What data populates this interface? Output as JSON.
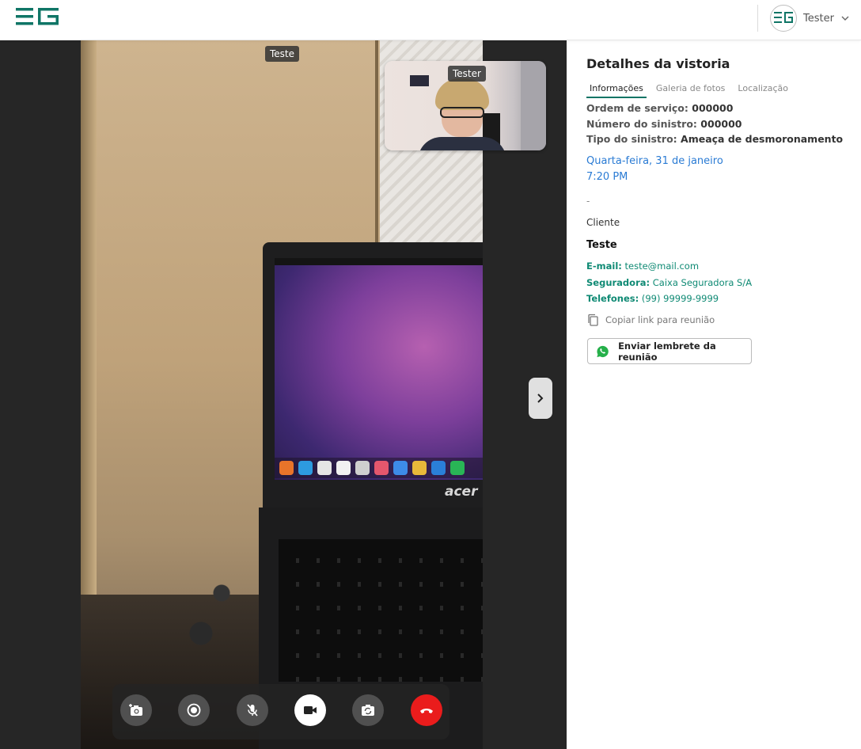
{
  "header": {
    "user_name": "Tester"
  },
  "video": {
    "main_participant_label": "Teste",
    "self_view_label": "Tester",
    "laptop_brand": "acer",
    "controls": [
      {
        "name": "snapshot",
        "icon": "camera-plus-icon"
      },
      {
        "name": "record",
        "icon": "record-icon"
      },
      {
        "name": "mute",
        "icon": "mic-off-icon"
      },
      {
        "name": "camera",
        "icon": "video-camera-icon"
      },
      {
        "name": "switch-camera",
        "icon": "switch-camera-icon"
      },
      {
        "name": "hang-up",
        "icon": "phone-hangup-icon"
      }
    ]
  },
  "panel": {
    "title": "Detalhes da vistoria",
    "tabs": [
      {
        "label": "Informações",
        "active": true
      },
      {
        "label": "Galeria de fotos",
        "active": false
      },
      {
        "label": "Localização",
        "active": false
      }
    ],
    "order_label": "Ordem de serviço:",
    "order_value": "000000",
    "claim_label": "Número do sinistro:",
    "claim_value": "000000",
    "type_label": "Tipo do sinistro:",
    "type_value": "Ameaça de desmoronamento",
    "date": "Quarta-feira, 31 de janeiro",
    "time": "7:20 PM",
    "dash": "-",
    "client_label": "Cliente",
    "client_name": "Teste",
    "email_label": "E-mail:",
    "email_value": "teste@mail.com",
    "insurer_label": "Seguradora:",
    "insurer_value": "Caixa Seguradora S/A",
    "phones_label": "Telefones:",
    "phones_value": "(99) 99999-9999",
    "copy_link": "Copiar link para reunião",
    "whatsapp_button": "Enviar lembrete da reunião"
  },
  "colors": {
    "brand": "#0f7566",
    "link": "#2a7bd4",
    "contact": "#0f8a74",
    "hangup": "#ea1c1c"
  }
}
